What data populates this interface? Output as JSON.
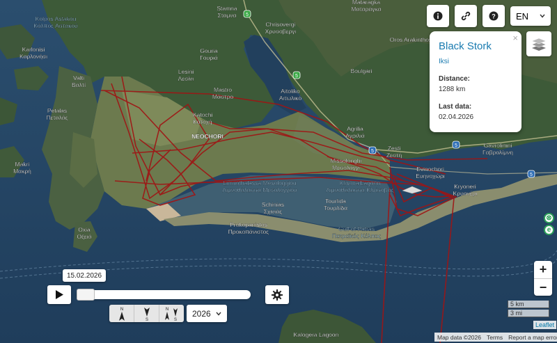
{
  "header": {
    "language": "EN",
    "info_icon": "info-icon",
    "link_icon": "link-icon",
    "help_icon": "help-icon"
  },
  "popup": {
    "title": "Black Stork",
    "name": "Iksi",
    "distance_label": "Distance:",
    "distance_value": "1288 km",
    "last_data_label": "Last data:",
    "last_data_value": "02.04.2026",
    "close_symbol": "×"
  },
  "playback": {
    "current_date": "15.02.2026",
    "position_fraction": 0.0,
    "year": "2026",
    "direction_labels": {
      "north": "N",
      "south": "S"
    }
  },
  "map": {
    "track_color": "#a01414",
    "road_badges": [
      "5",
      "5",
      "5",
      "5",
      "5"
    ],
    "places": [
      {
        "en": "Kolpos Astakou",
        "el": "Κόλπος Αστακού"
      },
      {
        "en": "Stamna",
        "el": "Σταμνα"
      },
      {
        "en": "Chrisovergi",
        "el": "Χρυσοβεργι"
      },
      {
        "en": "Mataragka",
        "el": "Ματαράγκα"
      },
      {
        "en": "Oros Arakinthos",
        "el": ""
      },
      {
        "en": "Karlonisi",
        "el": "Καρλονήσι"
      },
      {
        "en": "Gouria",
        "el": "Γουριά"
      },
      {
        "en": "Lesini",
        "el": "Λεσίνι"
      },
      {
        "en": "Valti",
        "el": "Βαλτί"
      },
      {
        "en": "Mastro",
        "el": "Μάστρο"
      },
      {
        "en": "Aitoliko",
        "el": "Αιτωλικό"
      },
      {
        "en": "Boulgári",
        "el": ""
      },
      {
        "en": "Petalas",
        "el": "Πεταλάς"
      },
      {
        "en": "Katochi",
        "el": "Κατοχή"
      },
      {
        "en": "NEOCHORI",
        "el": ""
      },
      {
        "en": "Agrilia",
        "el": "Αγριλιά"
      },
      {
        "en": "Gavrolimni",
        "el": "Γαβρολίμνη"
      },
      {
        "en": "Zesti",
        "el": "Ζεστή"
      },
      {
        "en": "Makri",
        "el": "Μακρή"
      },
      {
        "en": "Missolonghi",
        "el": "Μεσολόγγι"
      },
      {
        "en": "Evinochori",
        "el": "Ευηνοχώρι"
      },
      {
        "en": "Limnothalassa Mesologgiou",
        "el": "Λιμνοθάλασσα Μεσολογγίου"
      },
      {
        "en": "Klisova Lagoon",
        "el": "Λιμνοθάλασσα Κλείσοβας"
      },
      {
        "en": "Kryoneri",
        "el": "Κρυονέρι"
      },
      {
        "en": "Schinias",
        "el": "Σχινιάς"
      },
      {
        "en": "Tourlida",
        "el": "Τουρλίδα"
      },
      {
        "en": "Oxia",
        "el": "Οξειά"
      },
      {
        "en": "Prokopanistos",
        "el": "Προκοπάνιστος"
      },
      {
        "en": "Gulf of Patras",
        "el": "Πατραϊκός Κόλπος"
      },
      {
        "en": "Kalogera Lagoon",
        "el": ""
      }
    ]
  },
  "scale": {
    "km": "5 km",
    "mi": "3 mi"
  },
  "attribution": {
    "leaflet": "Leaflet",
    "map_data": "Map data ©2026",
    "terms": "Terms",
    "report": "Report a map error"
  },
  "side_icons": {
    "close": "⊗",
    "e": "e"
  }
}
